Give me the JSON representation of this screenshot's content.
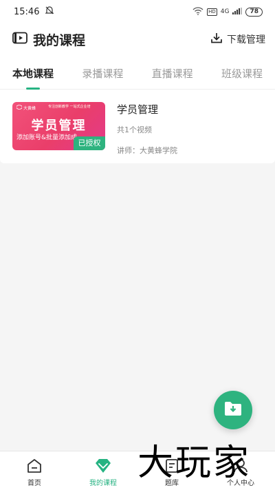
{
  "status_bar": {
    "time": "15:46",
    "network": "4G",
    "hd": "HD",
    "battery": "78",
    "icons": [
      "mute-bell-icon",
      "wifi-icon",
      "signal-icon",
      "battery-icon"
    ]
  },
  "header": {
    "title": "我的课程",
    "title_icon": "video-play-icon",
    "download_label": "下载管理",
    "download_icon": "download-icon"
  },
  "tabs": [
    {
      "label": "本地课程",
      "active": true
    },
    {
      "label": "录播课程",
      "active": false
    },
    {
      "label": "直播课程",
      "active": false
    },
    {
      "label": "班级课程",
      "active": false
    }
  ],
  "courses": [
    {
      "thumb_logo": "大黄蜂",
      "thumb_slogan": "专注创新教学 一站式企业培",
      "thumb_title": "学员管理",
      "thumb_sub": "添加账号&批量添加成",
      "badge": "已授权",
      "title": "学员管理",
      "count": "共1个视频",
      "teacher": "讲师：大黄蜂学院"
    }
  ],
  "fab": {
    "icon": "folder-download-icon"
  },
  "bottom_nav": [
    {
      "label": "首页",
      "icon": "home-icon",
      "active": false
    },
    {
      "label": "我的课程",
      "icon": "diamond-icon",
      "active": true
    },
    {
      "label": "题库",
      "icon": "note-icon",
      "active": false
    },
    {
      "label": "个人中心",
      "icon": "user-icon",
      "active": false
    }
  ],
  "watermark": "大玩家",
  "colors": {
    "accent": "#26b382",
    "thumb_pink": "#ea3e6a"
  }
}
